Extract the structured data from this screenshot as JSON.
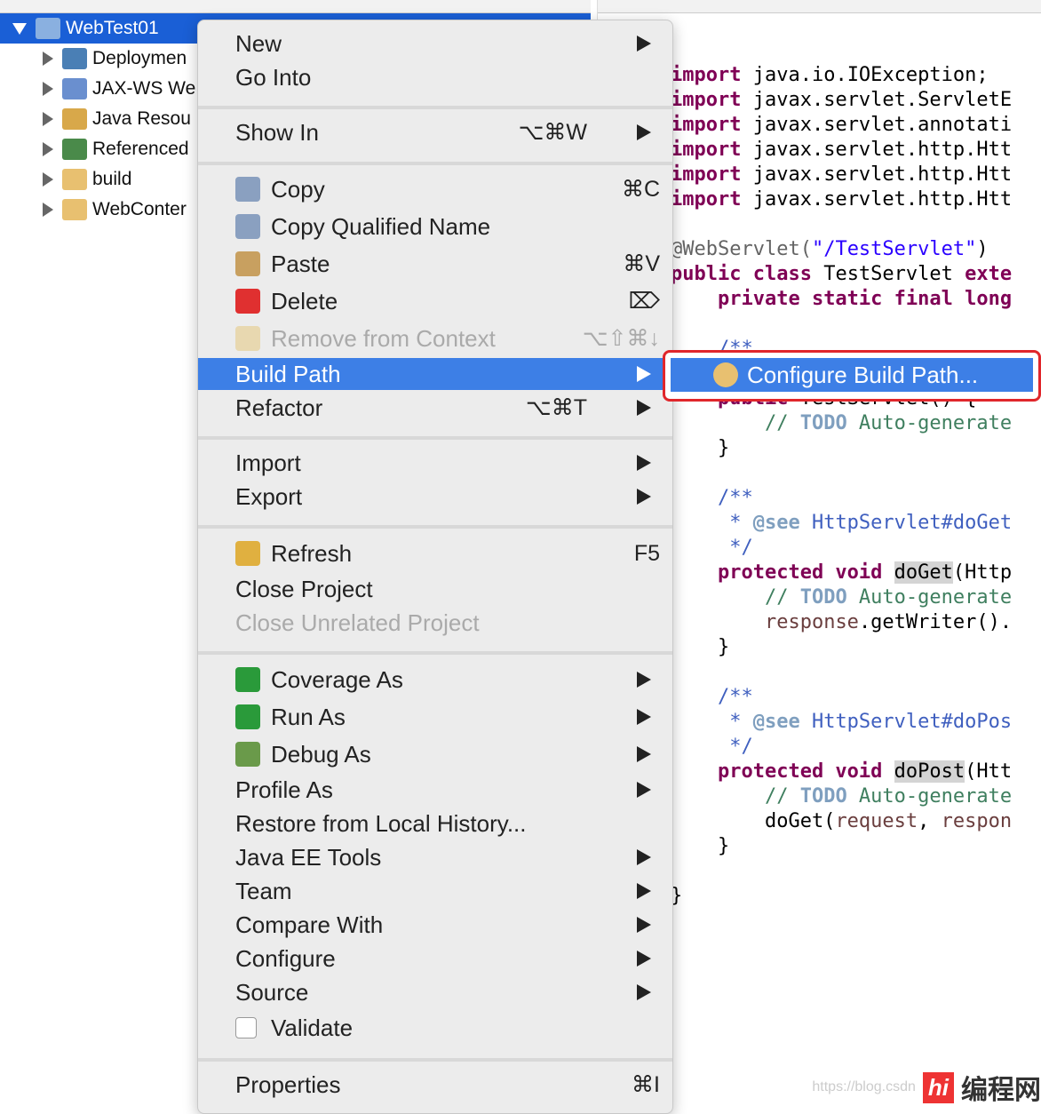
{
  "explorer": {
    "project": "WebTest01",
    "items": [
      {
        "label": "Deploymen",
        "icon": "deployment-descriptor-icon",
        "color": "#4a7fb5"
      },
      {
        "label": "JAX-WS We",
        "icon": "jaxws-icon",
        "color": "#6a8fcf"
      },
      {
        "label": "Java Resou",
        "icon": "java-resources-icon",
        "color": "#d8a84a"
      },
      {
        "label": "Referenced",
        "icon": "libraries-icon",
        "color": "#4a8a4a"
      },
      {
        "label": "build",
        "icon": "folder-icon",
        "color": "#e8c070"
      },
      {
        "label": "WebConter",
        "icon": "folder-icon",
        "color": "#e8c070"
      }
    ]
  },
  "menu": {
    "items": [
      {
        "label": "New",
        "submenu": true
      },
      {
        "label": "Go Into"
      },
      {
        "sep": true
      },
      {
        "label": "Show In",
        "shortcut": "⌥⌘W",
        "submenu": true
      },
      {
        "sep": true
      },
      {
        "label": "Copy",
        "shortcut": "⌘C",
        "icon": "copy-icon",
        "color": "#8aa0c0"
      },
      {
        "label": "Copy Qualified Name",
        "icon": "copy-qualified-name-icon",
        "color": "#8aa0c0"
      },
      {
        "label": "Paste",
        "shortcut": "⌘V",
        "icon": "paste-icon",
        "color": "#c8a060"
      },
      {
        "label": "Delete",
        "shortcut": "⌦",
        "icon": "delete-icon",
        "color": "#e03030"
      },
      {
        "label": "Remove from Context",
        "shortcut": "⌥⇧⌘↓",
        "icon": "remove-from-context-icon",
        "color": "#e8d8b0",
        "disabled": true
      },
      {
        "label": "Build Path",
        "submenu": true,
        "active": true
      },
      {
        "label": "Refactor",
        "shortcut": "⌥⌘T",
        "submenu": true
      },
      {
        "sep": true
      },
      {
        "label": "Import",
        "submenu": true
      },
      {
        "label": "Export",
        "submenu": true
      },
      {
        "sep": true
      },
      {
        "label": "Refresh",
        "shortcut": "F5",
        "icon": "refresh-icon",
        "color": "#e0b040"
      },
      {
        "label": "Close Project"
      },
      {
        "label": "Close Unrelated Project",
        "disabled": true
      },
      {
        "sep": true
      },
      {
        "label": "Coverage As",
        "submenu": true,
        "icon": "coverage-icon",
        "color": "#2a9a3a"
      },
      {
        "label": "Run As",
        "submenu": true,
        "icon": "run-icon",
        "color": "#2a9a3a"
      },
      {
        "label": "Debug As",
        "submenu": true,
        "icon": "debug-icon",
        "color": "#6a9a4a"
      },
      {
        "label": "Profile As",
        "submenu": true
      },
      {
        "label": "Restore from Local History..."
      },
      {
        "label": "Java EE Tools",
        "submenu": true
      },
      {
        "label": "Team",
        "submenu": true
      },
      {
        "label": "Compare With",
        "submenu": true
      },
      {
        "label": "Configure",
        "submenu": true
      },
      {
        "label": "Source",
        "submenu": true
      },
      {
        "label": "Validate",
        "icon": "checkbox-checked-icon",
        "color": "#ffffff"
      },
      {
        "sep": true
      },
      {
        "label": "Properties",
        "shortcut": "⌘I"
      }
    ]
  },
  "submenu": {
    "label": "Configure Build Path...",
    "icon": "configure-build-path-icon"
  },
  "code": [
    [
      [
        "import",
        "kw"
      ],
      [
        " java.io.IOException;",
        ""
      ]
    ],
    [
      [
        "import",
        "kw"
      ],
      [
        " javax.servlet.ServletE",
        ""
      ]
    ],
    [
      [
        "import",
        "kw"
      ],
      [
        " javax.servlet.annotati",
        ""
      ]
    ],
    [
      [
        "import",
        "kw"
      ],
      [
        " javax.servlet.http.Htt",
        ""
      ]
    ],
    [
      [
        "import",
        "kw"
      ],
      [
        " javax.servlet.http.Htt",
        ""
      ]
    ],
    [
      [
        "import",
        "kw"
      ],
      [
        " javax.servlet.http.Htt",
        ""
      ]
    ],
    [],
    [
      [
        "@WebServlet(",
        "ann"
      ],
      [
        "\"/TestServlet\"",
        "str"
      ],
      [
        ")",
        ""
      ]
    ],
    [
      [
        "public class",
        "kw"
      ],
      [
        " TestServlet ",
        ""
      ],
      [
        "exte",
        "kw"
      ]
    ],
    [
      [
        "    ",
        " "
      ],
      [
        "private static final long",
        "kw"
      ]
    ],
    [],
    [
      [
        "    /**",
        "doc"
      ]
    ],
    [
      [
        "     */",
        "doc"
      ]
    ],
    [
      [
        "    ",
        ""
      ],
      [
        "public",
        "kw"
      ],
      [
        " TestServlet() {",
        ""
      ]
    ],
    [
      [
        "        // ",
        "cmt"
      ],
      [
        "TODO",
        "todo"
      ],
      [
        " Auto-generate",
        "cmt"
      ]
    ],
    [
      [
        "    }",
        ""
      ]
    ],
    [],
    [
      [
        "    /**",
        "doc"
      ]
    ],
    [
      [
        "     * ",
        "doc"
      ],
      [
        "@see",
        "dtag"
      ],
      [
        " HttpServlet#doGet",
        "doc"
      ]
    ],
    [
      [
        "     */",
        "doc"
      ]
    ],
    [
      [
        "    ",
        ""
      ],
      [
        "protected void",
        "kw"
      ],
      [
        " ",
        ""
      ],
      [
        "doGet",
        "hl"
      ],
      [
        "(Http",
        ""
      ]
    ],
    [
      [
        "        // ",
        "cmt"
      ],
      [
        "TODO",
        "todo"
      ],
      [
        " Auto-generate",
        "cmt"
      ]
    ],
    [
      [
        "        ",
        ""
      ],
      [
        "response",
        "var"
      ],
      [
        ".getWriter().",
        ""
      ]
    ],
    [
      [
        "    }",
        ""
      ]
    ],
    [],
    [
      [
        "    /**",
        "doc"
      ]
    ],
    [
      [
        "     * ",
        "doc"
      ],
      [
        "@see",
        "dtag"
      ],
      [
        " HttpServlet#doPos",
        "doc"
      ]
    ],
    [
      [
        "     */",
        "doc"
      ]
    ],
    [
      [
        "    ",
        ""
      ],
      [
        "protected void",
        "kw"
      ],
      [
        " ",
        ""
      ],
      [
        "doPost",
        "hl"
      ],
      [
        "(Htt",
        ""
      ]
    ],
    [
      [
        "        // ",
        "cmt"
      ],
      [
        "TODO",
        "todo"
      ],
      [
        " Auto-generate",
        "cmt"
      ]
    ],
    [
      [
        "        doGet(",
        ""
      ],
      [
        "request",
        "var"
      ],
      [
        ", ",
        ""
      ],
      [
        "respon",
        "var"
      ]
    ],
    [
      [
        "    }",
        ""
      ]
    ],
    [],
    [
      [
        "}",
        ""
      ]
    ]
  ],
  "watermark": {
    "url": "https://blog.csdn",
    "brand": "编程网",
    "logo": "hi"
  },
  "colors": {
    "selection": "#1a5fd6",
    "menu_highlight": "#3d7fe6",
    "callout": "#e0262b"
  }
}
